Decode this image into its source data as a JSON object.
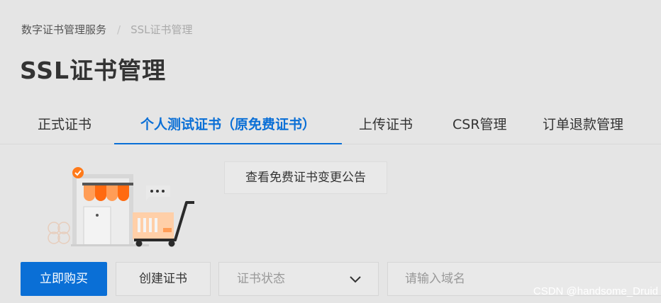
{
  "breadcrumb": {
    "root": "数字证书管理服务",
    "separator": "/",
    "current": "SSL证书管理"
  },
  "page": {
    "title": "SSL证书管理"
  },
  "tabs": [
    {
      "label": "正式证书",
      "active": false
    },
    {
      "label": "个人测试证书（原免费证书）",
      "active": true
    },
    {
      "label": "上传证书",
      "active": false
    },
    {
      "label": "CSR管理",
      "active": false
    },
    {
      "label": "订单退款管理",
      "active": false
    }
  ],
  "notice": {
    "label": "查看免费证书变更公告"
  },
  "toolbar": {
    "buy_label": "立即购买",
    "create_label": "创建证书",
    "status_placeholder": "证书状态",
    "domain_placeholder": "请输入域名"
  },
  "watermark": "CSDN @handsome_Druid",
  "colors": {
    "accent": "#0a6fd6",
    "illustration_orange": "#ff7a1a"
  },
  "icons": {
    "illustration": "store-and-shopping-cart-illustration",
    "status_dropdown": "chevron-down-icon"
  }
}
